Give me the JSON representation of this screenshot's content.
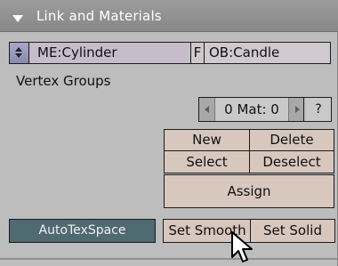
{
  "panel": {
    "title": "Link and Materials"
  },
  "link_row": {
    "mesh_name": "ME:Cylinder",
    "fake_user": "F",
    "object_name": "OB:Candle"
  },
  "vertex_groups": {
    "label": "Vertex Groups"
  },
  "material": {
    "value": "0 Mat: 0",
    "help": "?"
  },
  "buttons": {
    "new": "New",
    "delete": "Delete",
    "select": "Select",
    "deselect": "Deselect",
    "assign": "Assign",
    "auto_tex_space": "AutoTexSpace",
    "set_smooth": "Set Smooth",
    "set_solid": "Set Solid"
  },
  "colors": {
    "panel_bg": "#bdbdbd",
    "header_bg": "#909090",
    "mesh_field": "#c7bccb",
    "action_button": "#d7c7bd",
    "toggle_active": "#4f6a70"
  },
  "icons": {
    "header": "triangle-down-icon",
    "browse": "up-down-arrows-icon",
    "decrement": "left-arrow-icon",
    "increment": "right-arrow-icon",
    "cursor": "mouse-pointer-icon"
  }
}
